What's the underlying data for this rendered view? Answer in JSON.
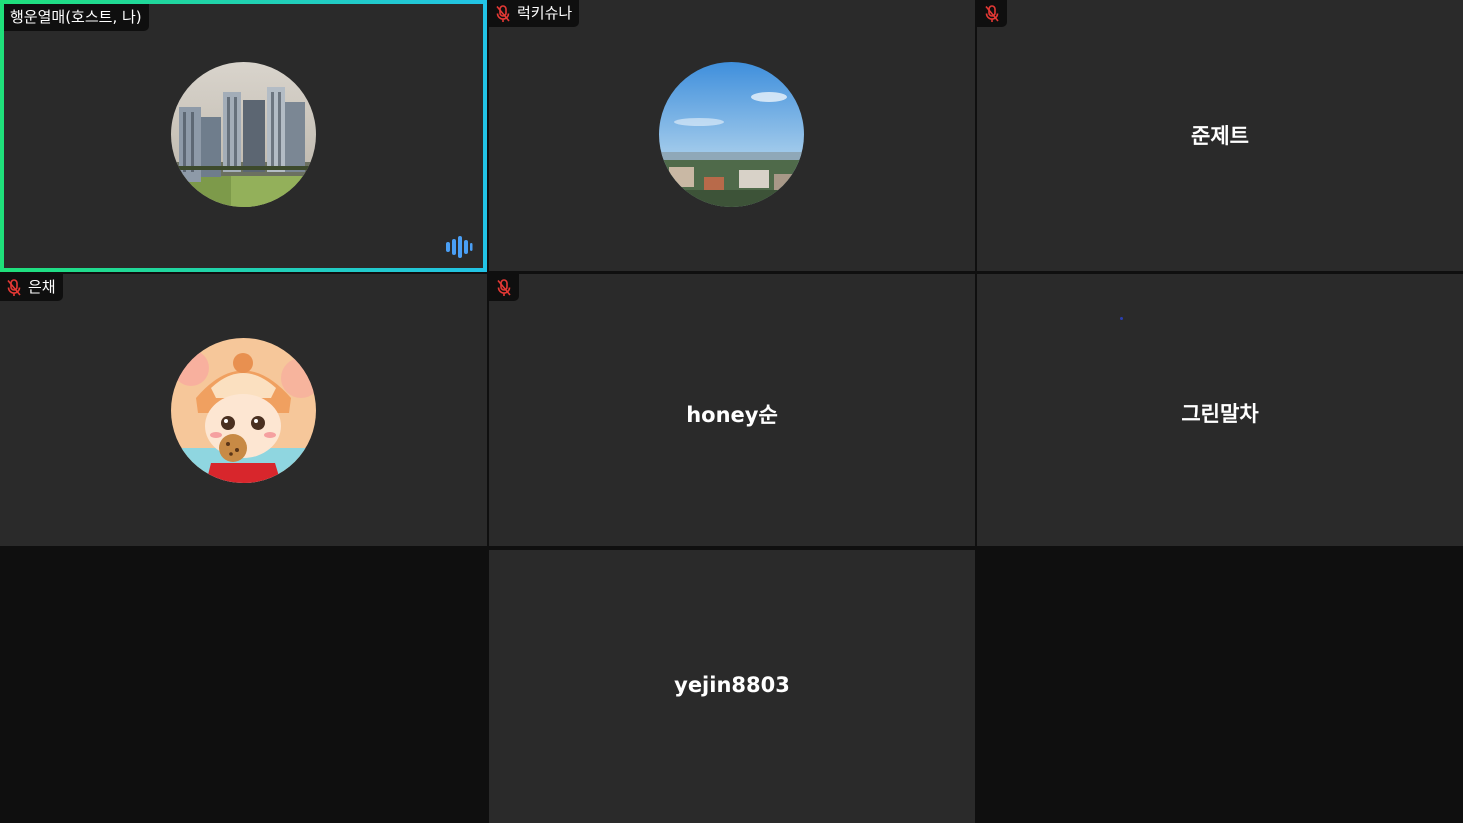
{
  "participants": [
    {
      "name": "행운열매(호스트, 나)",
      "muted": false,
      "speaking": true,
      "avatar": "apartment-buildings-photo"
    },
    {
      "name": "럭키슈나",
      "muted": true,
      "speaking": false,
      "avatar": "city-sky-photo"
    },
    {
      "name": "",
      "display_name": "준제트",
      "muted": true,
      "speaking": false
    },
    {
      "name": "은채",
      "muted": true,
      "speaking": false,
      "avatar": "cartoon-child-cookie-illustration"
    },
    {
      "name": "",
      "display_name": "honey순",
      "muted": true,
      "speaking": false
    },
    {
      "name": "",
      "display_name": "그린말차",
      "muted": false,
      "speaking": false
    },
    {
      "name": "",
      "display_name": "yejin8803",
      "muted": false,
      "speaking": false
    }
  ],
  "colors": {
    "tile_bg": "#2a2a2a",
    "page_bg": "#0f0f0f",
    "active_border_start": "#1fe07a",
    "active_border_end": "#22c3e6",
    "mic_off": "#e53935",
    "speaking": "#4a9ff5"
  }
}
